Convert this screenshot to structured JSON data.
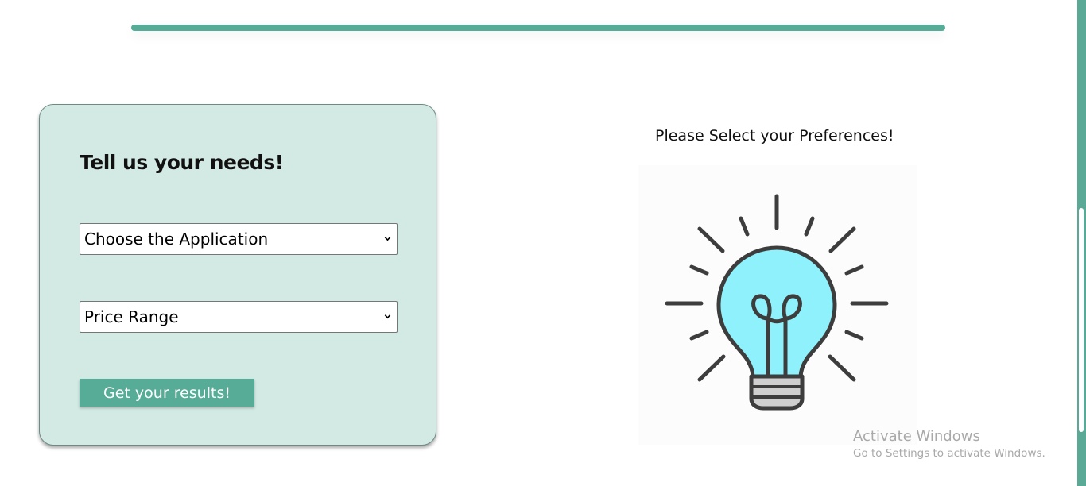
{
  "colors": {
    "accent": "#56ac97",
    "card_bg": "#d3eae4",
    "bulb_glass": "#8ef1fb",
    "bulb_stroke": "#3d3d3d"
  },
  "form": {
    "title": "Tell us your needs!",
    "application_select": {
      "selected": "Choose the Application"
    },
    "price_select": {
      "selected": "Price Range"
    },
    "submit_label": "Get your results!"
  },
  "preferences": {
    "title": "Please Select your Preferences!",
    "illustration_icon": "lightbulb-icon"
  },
  "watermark": {
    "title": "Activate Windows",
    "subtitle": "Go to Settings to activate Windows."
  }
}
